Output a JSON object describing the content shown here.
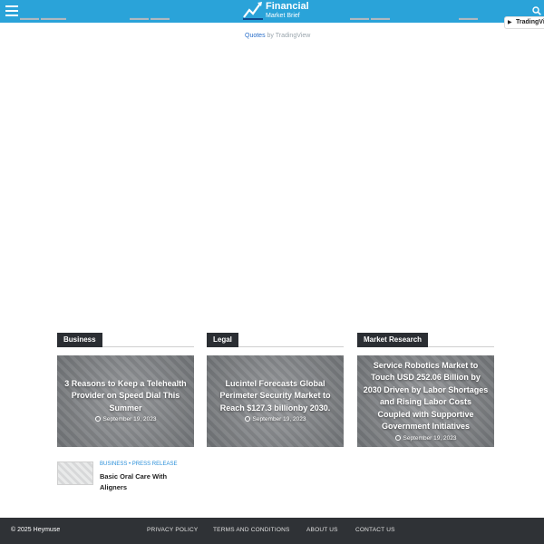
{
  "header": {
    "logo_line1": "Financial",
    "logo_line2": "Market Brief",
    "brand_color": "#2aa3d9"
  },
  "ticker": {
    "widget_badge": "TradingView",
    "quotes_link": "Quotes",
    "quotes_suffix": "by TradingView"
  },
  "categories": [
    {
      "label": "Business"
    },
    {
      "label": "Legal"
    },
    {
      "label": "Market Research"
    }
  ],
  "cards": [
    {
      "title": "3 Reasons to Keep a Telehealth Provider on Speed Dial This Summer",
      "date": "September 19, 2023"
    },
    {
      "title": "Lucintel Forecasts Global Perimeter Security Market to Reach $127.3 billionby 2030.",
      "date": "September 19, 2023"
    },
    {
      "title": "Service Robotics Market to Touch USD 252.06 Billion by 2030 Driven by Labor Shortages and Rising Labor Costs Coupled with Supportive Government Initiatives",
      "date": "September 19, 2023"
    }
  ],
  "small_post": {
    "tags": "BUSINESS • PRESS RELEASE",
    "title": "Basic Oral Care With Aligners"
  },
  "footer": {
    "copyright": "© 2025",
    "brand": "Heymuse",
    "nav": [
      "PRIVACY POLICY",
      "TERMS AND CONDITIONS",
      "ABOUT US",
      "CONTACT US"
    ]
  }
}
